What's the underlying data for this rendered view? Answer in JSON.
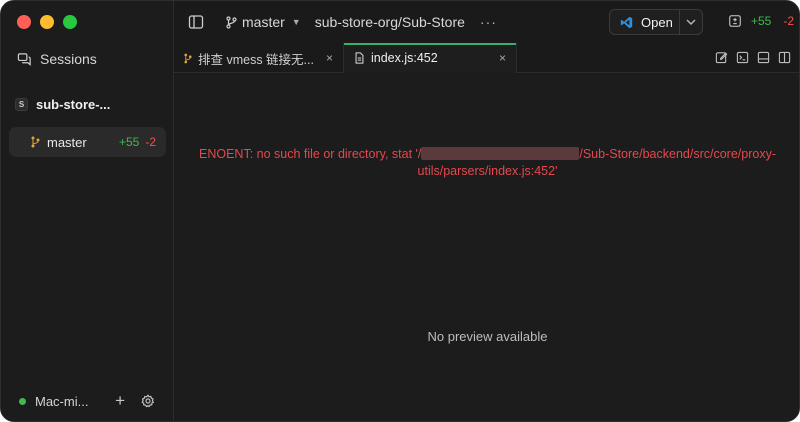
{
  "sidebar": {
    "sessions_label": "Sessions",
    "repo": {
      "badge": "S",
      "name": "sub-store-..."
    },
    "branch": {
      "name": "master",
      "added": "+55",
      "removed": "-2"
    },
    "footer": {
      "machine": "Mac-mi...",
      "add": "+",
      "status_color": "#3fb950"
    }
  },
  "topbar": {
    "branch": "master",
    "repo_path": "sub-store-org/Sub-Store",
    "more": "···",
    "open_label": "Open",
    "diff_added": "+55",
    "diff_removed": "-2"
  },
  "tabs": [
    {
      "label": "排查 vmess 链接无...",
      "close": "×",
      "active": false
    },
    {
      "label": "index.js:452",
      "close": "×",
      "active": true
    }
  ],
  "content": {
    "error_prefix": "ENOENT: no such file or directory, stat '/",
    "error_suffix": "/Sub-Store/backend/src/core/proxy-",
    "error_line2": "utils/parsers/index.js:452'",
    "empty_state": "No preview available"
  },
  "colors": {
    "accent": "#35b06d",
    "added": "#3fb950",
    "removed": "#f85149",
    "error": "#e5484d"
  }
}
